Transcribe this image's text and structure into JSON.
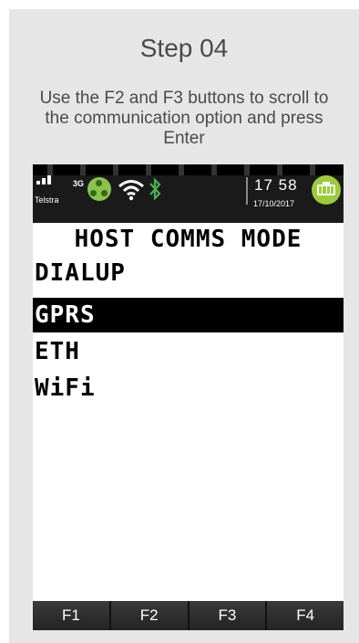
{
  "instructions": {
    "step_title": "Step 04",
    "text": "Use the F2 and F3 buttons to scroll to the communication option and press Enter"
  },
  "status_bar": {
    "carrier": "Telstra",
    "network": "3G",
    "time": "17 58",
    "date": "17/10/2017",
    "icons": [
      "signal-bars-icon",
      "gprs-icon",
      "wifi-icon",
      "bluetooth-icon",
      "battery-icon"
    ],
    "colors": {
      "gprs": "#8bc34a",
      "bluetooth": "#4caf50",
      "battery": "#9ccc3b"
    }
  },
  "terminal": {
    "title": "HOST COMMS MODE",
    "options": [
      "DIALUP",
      "GPRS",
      "ETH",
      "WiFi"
    ],
    "selected": "GPRS"
  },
  "function_keys": [
    "F1",
    "F2",
    "F3",
    "F4"
  ]
}
